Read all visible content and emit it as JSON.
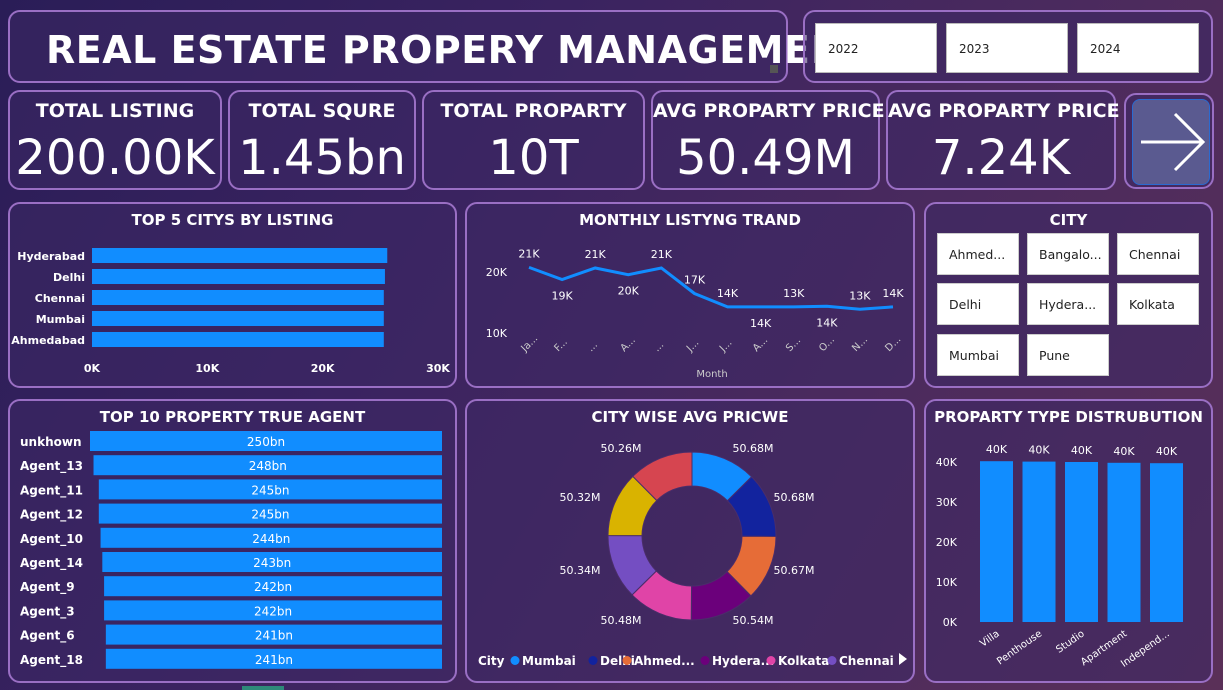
{
  "header": {
    "title": "REAL ESTATE PROPERY MANAGEMENT"
  },
  "years": [
    "2022",
    "2023",
    "2024"
  ],
  "kpis": [
    {
      "label": "TOTAL LISTING",
      "value": "200.00K"
    },
    {
      "label": "TOTAL SQURE",
      "value": "1.45bn"
    },
    {
      "label": "TOTAL PROPARTY",
      "value": "10T"
    },
    {
      "label": "AVG PROPARTY PRICE",
      "value": "50.49M"
    },
    {
      "label": "AVG PROPARTY PRICE",
      "value": "7.24K"
    }
  ],
  "nav": {
    "next_icon": "arrow-right-icon"
  },
  "city_slicer": {
    "title": "CITY",
    "items": [
      "Ahmed...",
      "Bangalo...",
      "Chennai",
      "Delhi",
      "Hydera...",
      "Kolkata",
      "Mumbai",
      "Pune"
    ]
  },
  "colors": {
    "bar": "#118dff",
    "line": "#118dff",
    "panel_border": "#9a6fc4"
  },
  "chart_data": [
    {
      "type": "bar",
      "orientation": "horizontal",
      "title": "TOP 5 CITYS BY LISTING",
      "categories": [
        "Hyderabad",
        "Delhi",
        "Chennai",
        "Mumbai",
        "Ahmedabad"
      ],
      "values": [
        25600,
        25400,
        25300,
        25300,
        25300
      ],
      "xlim": [
        0,
        30000
      ],
      "xticks": [
        "0K",
        "10K",
        "20K",
        "30K"
      ]
    },
    {
      "type": "line",
      "title": "MONTHLY LISTYNG TRAND",
      "xlabel": "Month",
      "categories": [
        "Ja...",
        "F...",
        "...",
        "A...",
        "...",
        "J...",
        "J...",
        "A...",
        "S...",
        "O...",
        "N...",
        "D..."
      ],
      "values": [
        20800,
        18800,
        20700,
        19600,
        20700,
        16500,
        14300,
        14300,
        14300,
        14400,
        13900,
        14300
      ],
      "point_labels": [
        "21K",
        "19K",
        "21K",
        "20K",
        "21K",
        "17K",
        "14K",
        "14K",
        "13K",
        "14K",
        "13K",
        "14K"
      ],
      "yticks": [
        "20K",
        "10K"
      ]
    },
    {
      "type": "bar",
      "orientation": "horizontal",
      "title": "TOP 10 PROPERTY TRUE AGENT",
      "categories": [
        "unkhown",
        "Agent_13",
        "Agent_11",
        "Agent_12",
        "Agent_10",
        "Agent_14",
        "Agent_9",
        "Agent_3",
        "Agent_6",
        "Agent_18"
      ],
      "values": [
        250,
        248,
        245,
        245,
        244,
        243,
        242,
        242,
        241,
        241
      ],
      "data_labels": [
        "250bn",
        "248bn",
        "245bn",
        "245bn",
        "244bn",
        "243bn",
        "242bn",
        "242bn",
        "241bn",
        "241bn"
      ]
    },
    {
      "type": "pie",
      "donut": true,
      "title": "CITY WISE AVG PRICWE",
      "legend_title": "City",
      "legend": [
        "Mumbai",
        "Delhi",
        "Ahmed...",
        "Hydera...",
        "Kolkata",
        "Chennai"
      ],
      "values": [
        50.68,
        50.68,
        50.67,
        50.54,
        50.48,
        50.34,
        50.32,
        50.26
      ],
      "data_labels": [
        "50.68M",
        "50.68M",
        "50.67M",
        "50.54M",
        "50.48M",
        "50.34M",
        "50.32M",
        "50.26M"
      ],
      "colors": [
        "#118dff",
        "#12239e",
        "#e66c37",
        "#6b007b",
        "#e044a7",
        "#744ec2",
        "#d9b300",
        "#d64550"
      ]
    },
    {
      "type": "bar",
      "title": "PROPARTY TYPE DISTRUBUTION",
      "categories": [
        "Villa",
        "Penthouse",
        "Studio",
        "Apartment",
        "Independ..."
      ],
      "values": [
        40200,
        40100,
        40000,
        39800,
        39700
      ],
      "data_labels": [
        "40K",
        "40K",
        "40K",
        "40K",
        "40K"
      ],
      "ylim": [
        0,
        40000
      ],
      "yticks": [
        "40K",
        "30K",
        "20K",
        "10K",
        "0K"
      ]
    }
  ]
}
